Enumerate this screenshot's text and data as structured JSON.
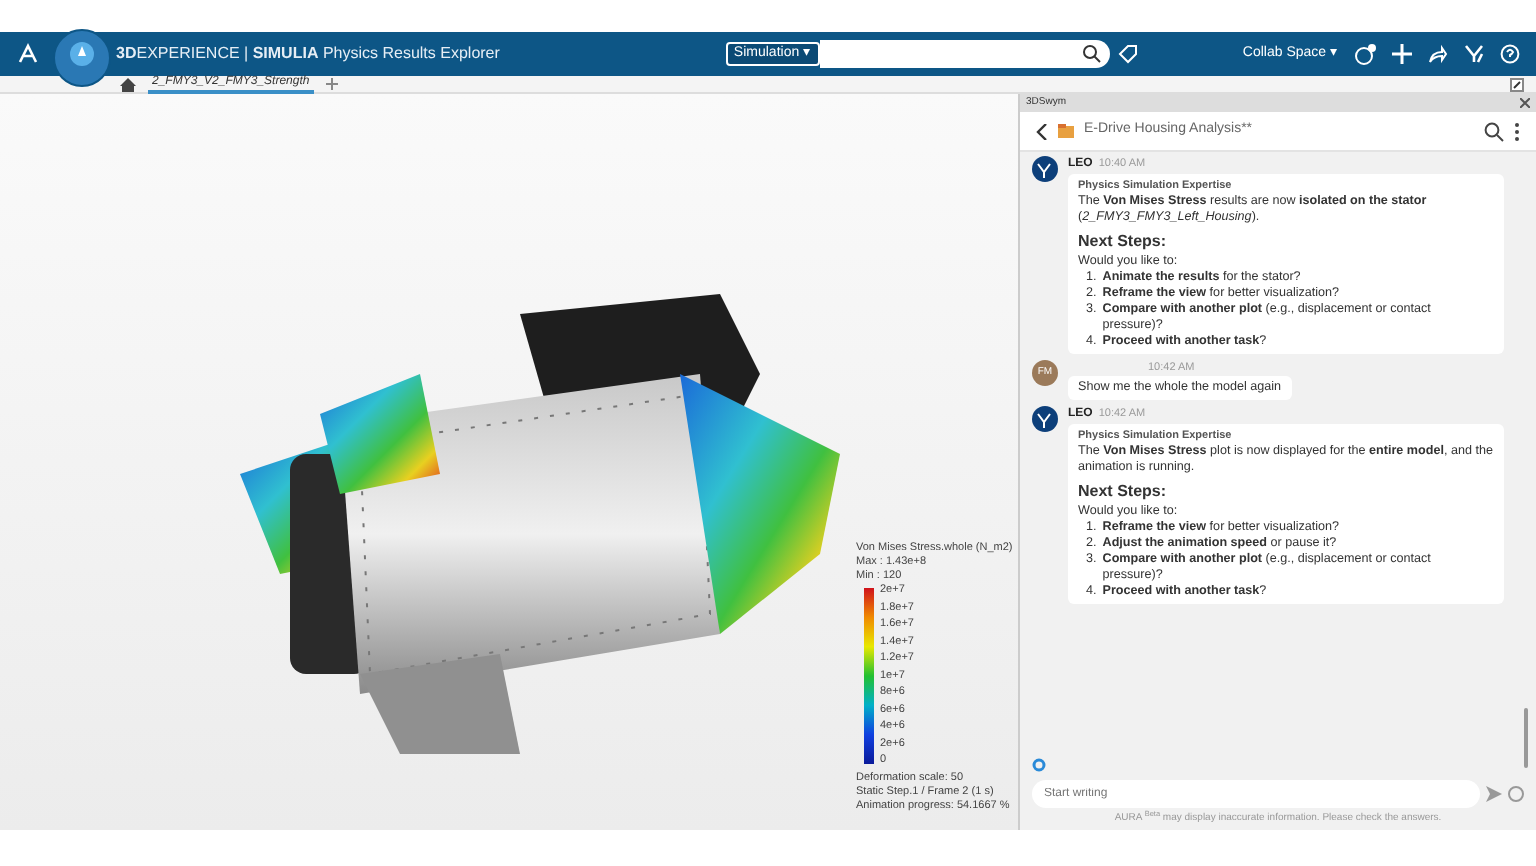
{
  "app_bar": {
    "title": "**3D**EXPERIENCE | **SIMULIA** Physics Results Explorer",
    "search_scope": "Simulation ▾",
    "collab_space": "Collab Space ▾"
  },
  "tabs": [
    {
      "label": "2_FMY3_V2_FMY3_Strength",
      "selected": true
    }
  ],
  "viewer": {
    "legend": {
      "title": "Von Mises Stress.whole (N_m2)",
      "max": "Max : 1.43e+8",
      "min": "Min : 120",
      "ticks": [
        "2e+7",
        "1.8e+7",
        "1.6e+7",
        "1.4e+7",
        "1.2e+7",
        "1e+7",
        "8e+6",
        "6e+6",
        "4e+6",
        "2e+6",
        "0"
      ],
      "footer": [
        "Deformation scale: 50",
        "Static Step.1 / Frame 2 (1 s)",
        "Animation progress: 54.1667 %"
      ]
    }
  },
  "chat_panel": {
    "window_title": "3DSwym",
    "conversation_title": "E-Drive Housing Analysis**",
    "messages": [
      {
        "kind": "bot",
        "sender": "LEO",
        "time": "10:40 AM",
        "role": "Physics Simulation Expertise",
        "text": "The **Von Mises Stress** results are now **isolated on the stator** (*2_FMY3_FMY3_Left_Housing*).",
        "heading": "Next Steps:",
        "intro": "Would you like to:",
        "steps": [
          {
            "number": "1.",
            "text": "**Animate the results** for the stator?"
          },
          {
            "number": "2.",
            "text": "**Reframe the view** for better visualization?"
          },
          {
            "number": "3.",
            "text": "**Compare with another plot** (e.g., displacement or contact pressure)?"
          },
          {
            "number": "4.",
            "text": "**Proceed with another task**?"
          }
        ]
      },
      {
        "kind": "user",
        "initials": "FM",
        "time": "10:42 AM",
        "text": "Show me the whole the model again"
      },
      {
        "kind": "bot",
        "sender": "LEO",
        "time": "10:42 AM",
        "role": "Physics Simulation Expertise",
        "text": "The **Von Mises Stress** plot is now displayed for the **entire model**, and the animation is running.",
        "heading": "Next Steps:",
        "intro": "Would you like to:",
        "steps": [
          {
            "number": "1.",
            "text": "**Reframe the view** for better visualization?"
          },
          {
            "number": "2.",
            "text": "**Adjust the animation speed** or pause it?"
          },
          {
            "number": "3.",
            "text": "**Compare with another plot** (e.g., displacement or contact pressure)?"
          },
          {
            "number": "4.",
            "text": "**Proceed with another task**?"
          }
        ]
      }
    ],
    "input": {
      "placeholder": "Start writing"
    },
    "disclaimer": "AURA $^{Beta}$ may display inaccurate information. Please check the answers."
  }
}
